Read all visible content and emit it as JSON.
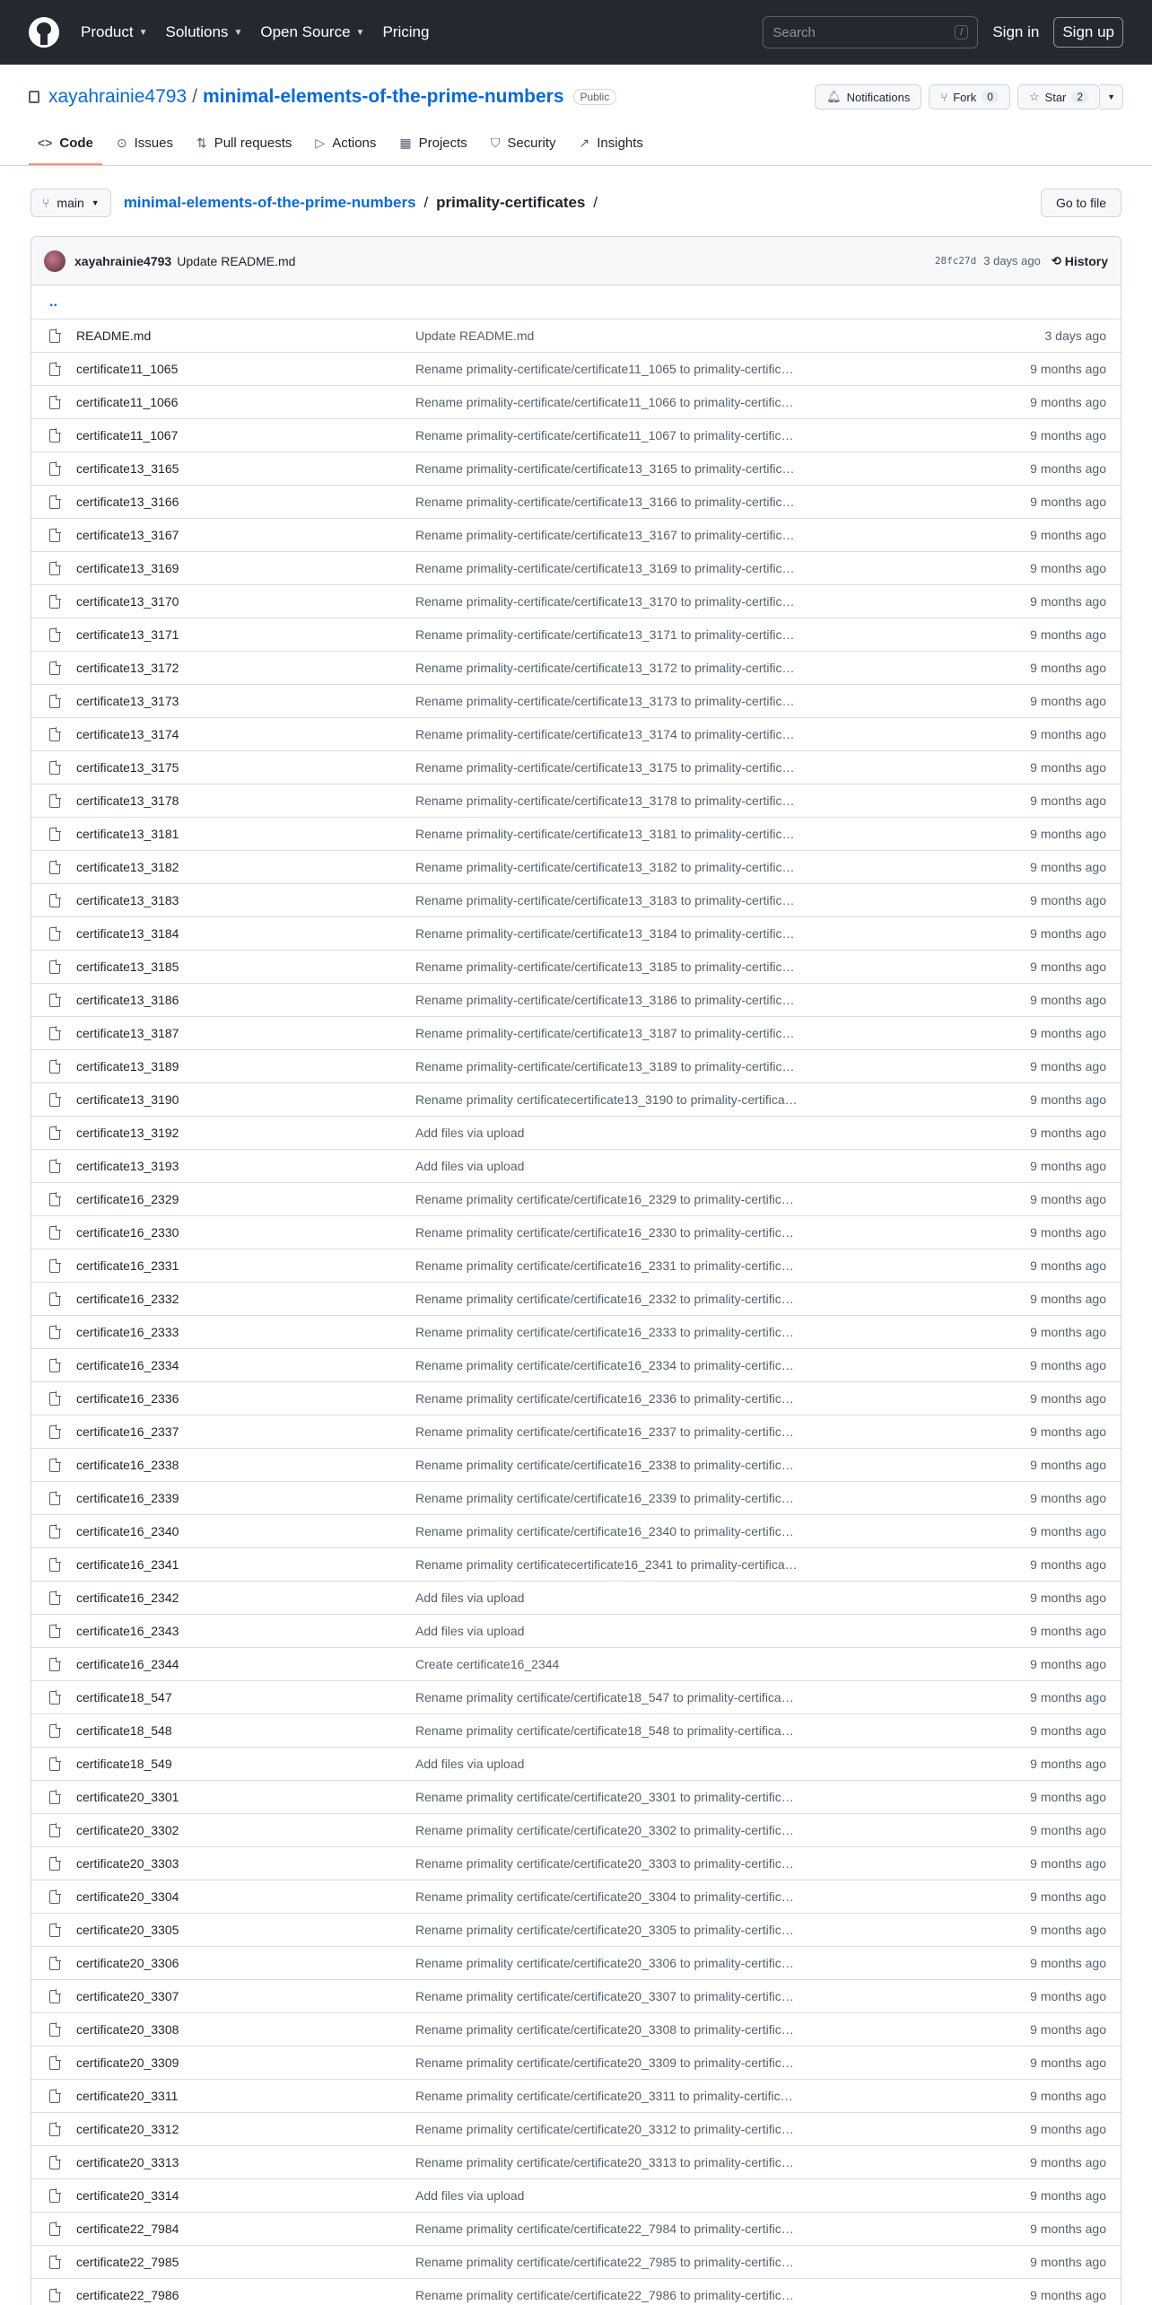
{
  "header": {
    "nav": [
      "Product",
      "Solutions",
      "Open Source",
      "Pricing"
    ],
    "search_placeholder": "Search",
    "search_shortcut": "/",
    "sign_in": "Sign in",
    "sign_up": "Sign up"
  },
  "repo": {
    "owner": "xayahrainie4793",
    "separator": "/",
    "name": "minimal-elements-of-the-prime-numbers",
    "visibility": "Public",
    "notifications_label": "Notifications",
    "fork_label": "Fork",
    "fork_count": "0",
    "star_label": "Star",
    "star_count": "2"
  },
  "tabs": [
    {
      "label": "Code",
      "icon": "code-icon"
    },
    {
      "label": "Issues",
      "icon": "issue-icon"
    },
    {
      "label": "Pull requests",
      "icon": "pull-request-icon"
    },
    {
      "label": "Actions",
      "icon": "actions-icon"
    },
    {
      "label": "Projects",
      "icon": "projects-icon"
    },
    {
      "label": "Security",
      "icon": "shield-icon"
    },
    {
      "label": "Insights",
      "icon": "graph-icon"
    }
  ],
  "path": {
    "branch": "main",
    "repo": "minimal-elements-of-the-prime-numbers",
    "sep": "/",
    "dir": "primality-certificates",
    "trailing": "/",
    "go_to_file": "Go to file"
  },
  "commit": {
    "user": "xayahrainie4793",
    "message": "Update README.md",
    "sha": "28fc27d",
    "age": "3 days ago",
    "history": "History"
  },
  "parent_dir": "..",
  "files": [
    {
      "name": "README.md",
      "msg": "Update README.md",
      "age": "3 days ago"
    },
    {
      "name": "certificate11_1065",
      "msg": "Rename primality-certificate/certificate11_1065 to primality-certific…",
      "age": "9 months ago"
    },
    {
      "name": "certificate11_1066",
      "msg": "Rename primality-certificate/certificate11_1066 to primality-certific…",
      "age": "9 months ago"
    },
    {
      "name": "certificate11_1067",
      "msg": "Rename primality-certificate/certificate11_1067 to primality-certific…",
      "age": "9 months ago"
    },
    {
      "name": "certificate13_3165",
      "msg": "Rename primality-certificate/certificate13_3165 to primality-certific…",
      "age": "9 months ago"
    },
    {
      "name": "certificate13_3166",
      "msg": "Rename primality-certificate/certificate13_3166 to primality-certific…",
      "age": "9 months ago"
    },
    {
      "name": "certificate13_3167",
      "msg": "Rename primality-certificate/certificate13_3167 to primality-certific…",
      "age": "9 months ago"
    },
    {
      "name": "certificate13_3169",
      "msg": "Rename primality-certificate/certificate13_3169 to primality-certific…",
      "age": "9 months ago"
    },
    {
      "name": "certificate13_3170",
      "msg": "Rename primality-certificate/certificate13_3170 to primality-certific…",
      "age": "9 months ago"
    },
    {
      "name": "certificate13_3171",
      "msg": "Rename primality-certificate/certificate13_3171 to primality-certific…",
      "age": "9 months ago"
    },
    {
      "name": "certificate13_3172",
      "msg": "Rename primality-certificate/certificate13_3172 to primality-certific…",
      "age": "9 months ago"
    },
    {
      "name": "certificate13_3173",
      "msg": "Rename primality-certificate/certificate13_3173 to primality-certific…",
      "age": "9 months ago"
    },
    {
      "name": "certificate13_3174",
      "msg": "Rename primality-certificate/certificate13_3174 to primality-certific…",
      "age": "9 months ago"
    },
    {
      "name": "certificate13_3175",
      "msg": "Rename primality-certificate/certificate13_3175 to primality-certific…",
      "age": "9 months ago"
    },
    {
      "name": "certificate13_3178",
      "msg": "Rename primality-certificate/certificate13_3178 to primality-certific…",
      "age": "9 months ago"
    },
    {
      "name": "certificate13_3181",
      "msg": "Rename primality-certificate/certificate13_3181 to primality-certific…",
      "age": "9 months ago"
    },
    {
      "name": "certificate13_3182",
      "msg": "Rename primality-certificate/certificate13_3182 to primality-certific…",
      "age": "9 months ago"
    },
    {
      "name": "certificate13_3183",
      "msg": "Rename primality-certificate/certificate13_3183 to primality-certific…",
      "age": "9 months ago"
    },
    {
      "name": "certificate13_3184",
      "msg": "Rename primality-certificate/certificate13_3184 to primality-certific…",
      "age": "9 months ago"
    },
    {
      "name": "certificate13_3185",
      "msg": "Rename primality-certificate/certificate13_3185 to primality-certific…",
      "age": "9 months ago"
    },
    {
      "name": "certificate13_3186",
      "msg": "Rename primality-certificate/certificate13_3186 to primality-certific…",
      "age": "9 months ago"
    },
    {
      "name": "certificate13_3187",
      "msg": "Rename primality-certificate/certificate13_3187 to primality-certific…",
      "age": "9 months ago"
    },
    {
      "name": "certificate13_3189",
      "msg": "Rename primality-certificate/certificate13_3189 to primality-certific…",
      "age": "9 months ago"
    },
    {
      "name": "certificate13_3190",
      "msg": "Rename primality certificatecertificate13_3190 to primality-certifica…",
      "age": "9 months ago"
    },
    {
      "name": "certificate13_3192",
      "msg": "Add files via upload",
      "age": "9 months ago"
    },
    {
      "name": "certificate13_3193",
      "msg": "Add files via upload",
      "age": "9 months ago"
    },
    {
      "name": "certificate16_2329",
      "msg": "Rename primality certificate/certificate16_2329 to primality-certific…",
      "age": "9 months ago"
    },
    {
      "name": "certificate16_2330",
      "msg": "Rename primality certificate/certificate16_2330 to primality-certific…",
      "age": "9 months ago"
    },
    {
      "name": "certificate16_2331",
      "msg": "Rename primality certificate/certificate16_2331 to primality-certific…",
      "age": "9 months ago"
    },
    {
      "name": "certificate16_2332",
      "msg": "Rename primality certificate/certificate16_2332 to primality-certific…",
      "age": "9 months ago"
    },
    {
      "name": "certificate16_2333",
      "msg": "Rename primality certificate/certificate16_2333 to primality-certific…",
      "age": "9 months ago"
    },
    {
      "name": "certificate16_2334",
      "msg": "Rename primality certificate/certificate16_2334 to primality-certific…",
      "age": "9 months ago"
    },
    {
      "name": "certificate16_2336",
      "msg": "Rename primality certificate/certificate16_2336 to primality-certific…",
      "age": "9 months ago"
    },
    {
      "name": "certificate16_2337",
      "msg": "Rename primality certificate/certificate16_2337 to primality-certific…",
      "age": "9 months ago"
    },
    {
      "name": "certificate16_2338",
      "msg": "Rename primality certificate/certificate16_2338 to primality-certific…",
      "age": "9 months ago"
    },
    {
      "name": "certificate16_2339",
      "msg": "Rename primality certificate/certificate16_2339 to primality-certific…",
      "age": "9 months ago"
    },
    {
      "name": "certificate16_2340",
      "msg": "Rename primality certificate/certificate16_2340 to primality-certific…",
      "age": "9 months ago"
    },
    {
      "name": "certificate16_2341",
      "msg": "Rename primality certificatecertificate16_2341 to primality-certifica…",
      "age": "9 months ago"
    },
    {
      "name": "certificate16_2342",
      "msg": "Add files via upload",
      "age": "9 months ago"
    },
    {
      "name": "certificate16_2343",
      "msg": "Add files via upload",
      "age": "9 months ago"
    },
    {
      "name": "certificate16_2344",
      "msg": "Create certificate16_2344",
      "age": "9 months ago"
    },
    {
      "name": "certificate18_547",
      "msg": "Rename primality certificate/certificate18_547 to primality-certifica…",
      "age": "9 months ago"
    },
    {
      "name": "certificate18_548",
      "msg": "Rename primality certificate/certificate18_548 to primality-certifica…",
      "age": "9 months ago"
    },
    {
      "name": "certificate18_549",
      "msg": "Add files via upload",
      "age": "9 months ago"
    },
    {
      "name": "certificate20_3301",
      "msg": "Rename primality certificate/certificate20_3301 to primality-certific…",
      "age": "9 months ago"
    },
    {
      "name": "certificate20_3302",
      "msg": "Rename primality certificate/certificate20_3302 to primality-certific…",
      "age": "9 months ago"
    },
    {
      "name": "certificate20_3303",
      "msg": "Rename primality certificate/certificate20_3303 to primality-certific…",
      "age": "9 months ago"
    },
    {
      "name": "certificate20_3304",
      "msg": "Rename primality certificate/certificate20_3304 to primality-certific…",
      "age": "9 months ago"
    },
    {
      "name": "certificate20_3305",
      "msg": "Rename primality certificate/certificate20_3305 to primality-certific…",
      "age": "9 months ago"
    },
    {
      "name": "certificate20_3306",
      "msg": "Rename primality certificate/certificate20_3306 to primality-certific…",
      "age": "9 months ago"
    },
    {
      "name": "certificate20_3307",
      "msg": "Rename primality certificate/certificate20_3307 to primality-certific…",
      "age": "9 months ago"
    },
    {
      "name": "certificate20_3308",
      "msg": "Rename primality certificate/certificate20_3308 to primality-certific…",
      "age": "9 months ago"
    },
    {
      "name": "certificate20_3309",
      "msg": "Rename primality certificate/certificate20_3309 to primality-certific…",
      "age": "9 months ago"
    },
    {
      "name": "certificate20_3311",
      "msg": "Rename primality certificate/certificate20_3311 to primality-certific…",
      "age": "9 months ago"
    },
    {
      "name": "certificate20_3312",
      "msg": "Rename primality certificate/certificate20_3312 to primality-certific…",
      "age": "9 months ago"
    },
    {
      "name": "certificate20_3313",
      "msg": "Rename primality certificate/certificate20_3313 to primality-certific…",
      "age": "9 months ago"
    },
    {
      "name": "certificate20_3314",
      "msg": "Add files via upload",
      "age": "9 months ago"
    },
    {
      "name": "certificate22_7984",
      "msg": "Rename primality certificate/certificate22_7984 to primality-certific…",
      "age": "9 months ago"
    },
    {
      "name": "certificate22_7985",
      "msg": "Rename primality certificate/certificate22_7985 to primality-certific…",
      "age": "9 months ago"
    },
    {
      "name": "certificate22_7986",
      "msg": "Rename primality certificate/certificate22_7986 to primality-certific…",
      "age": "9 months ago"
    }
  ]
}
